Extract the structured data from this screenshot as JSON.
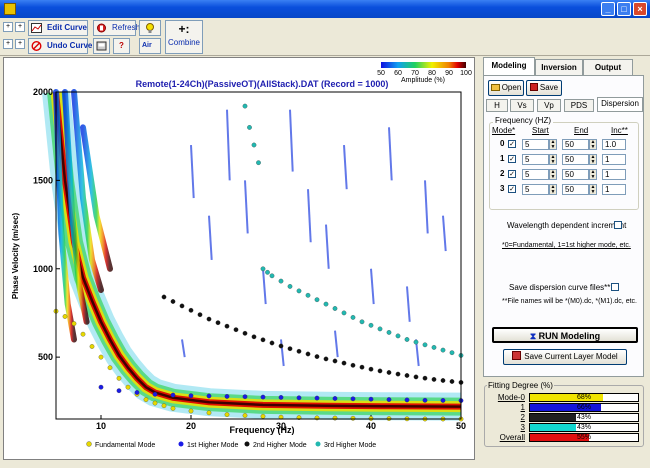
{
  "window": {
    "min": "_",
    "max": "□",
    "close": "×"
  },
  "toolbar": {
    "plus1": "+",
    "plus2": "+",
    "plus3": "+",
    "plus4": "+",
    "edit_curve": "Edit Curve",
    "undo_curve": "Undo Curve",
    "refresh": "Refresh",
    "bulb": "💡",
    "help": "?",
    "air": "Air",
    "combine": "Combine"
  },
  "plot": {
    "title": "Remote(1-24Ch)(PassiveOT)(AllStack).DAT (Record = 1000)",
    "colorbar_label": "Amplitude (%)",
    "colorbar_ticks": [
      "50",
      "60",
      "70",
      "80",
      "90",
      "100"
    ],
    "xlabel": "Frequency (Hz)",
    "ylabel": "Phase Velocity (m/sec)",
    "legend": [
      "Fundamental Mode",
      "1st Higher Mode",
      "2nd Higher Mode",
      "3rd Higher Mode"
    ]
  },
  "chart_data": {
    "type": "scatter",
    "title": "Remote(1-24Ch)(PassiveOT)(AllStack).DAT (Record = 1000)",
    "xlabel": "Frequency (Hz)",
    "ylabel": "Phase Velocity (m/sec)",
    "xlim": [
      5,
      50
    ],
    "ylim": [
      150,
      2000
    ],
    "xticks": [
      10,
      20,
      30,
      40,
      50
    ],
    "yticks": [
      500,
      1000,
      1500,
      2000
    ],
    "legend_position": "bottom",
    "series": [
      {
        "name": "Fundamental Mode",
        "color": "#e6d800",
        "x": [
          5,
          6,
          7,
          8,
          9,
          10,
          11,
          12,
          13,
          14,
          15,
          16,
          17,
          18,
          20,
          22,
          24,
          26,
          28,
          30,
          32,
          34,
          36,
          38,
          40,
          42,
          44,
          46,
          48,
          50
        ],
        "y": [
          760,
          730,
          690,
          630,
          560,
          500,
          440,
          380,
          330,
          290,
          260,
          240,
          225,
          210,
          195,
          185,
          175,
          170,
          165,
          160,
          158,
          156,
          155,
          154,
          153,
          152,
          151,
          150,
          150,
          150
        ]
      },
      {
        "name": "1st Higher Mode",
        "color": "#1a1ae6",
        "x": [
          10,
          12,
          14,
          16,
          18,
          20,
          22,
          24,
          26,
          28,
          30,
          32,
          34,
          36,
          38,
          40,
          42,
          44,
          46,
          48,
          50
        ],
        "y": [
          330,
          310,
          300,
          290,
          285,
          282,
          280,
          278,
          276,
          274,
          272,
          270,
          268,
          266,
          264,
          262,
          260,
          258,
          256,
          255,
          254
        ]
      },
      {
        "name": "2nd Higher Mode",
        "color": "#111111",
        "x": [
          17,
          18,
          19,
          20,
          21,
          22,
          23,
          24,
          25,
          26,
          27,
          28,
          29,
          30,
          31,
          32,
          33,
          34,
          35,
          36,
          37,
          38,
          39,
          40,
          41,
          42,
          43,
          44,
          45,
          46,
          47,
          48,
          49,
          50
        ],
        "y": [
          840,
          815,
          790,
          765,
          740,
          715,
          695,
          675,
          655,
          635,
          615,
          598,
          580,
          563,
          548,
          533,
          518,
          503,
          490,
          478,
          466,
          454,
          443,
          432,
          422,
          413,
          404,
          396,
          388,
          381,
          374,
          368,
          362,
          357
        ]
      },
      {
        "name": "3rd Higher Mode",
        "color": "#22b8b0",
        "x": [
          26,
          26.5,
          27,
          27.5,
          28,
          28.5,
          29,
          30,
          31,
          32,
          33,
          34,
          35,
          36,
          37,
          38,
          39,
          40,
          41,
          42,
          43,
          44,
          45,
          46,
          47,
          48,
          49,
          50
        ],
        "y": [
          1920,
          1800,
          1700,
          1600,
          1000,
          980,
          960,
          930,
          900,
          875,
          850,
          825,
          800,
          775,
          750,
          725,
          700,
          680,
          660,
          640,
          620,
          600,
          585,
          570,
          555,
          540,
          525,
          510
        ]
      }
    ]
  },
  "right": {
    "tabs": [
      "Modeling",
      "Inversion",
      "Output"
    ],
    "open": "Open",
    "save": "Save",
    "subtabs": [
      "H",
      "Vs",
      "Vp",
      "PDS",
      "Dispersion"
    ],
    "freq_group": "Frequency (HZ)",
    "cols": [
      "Mode*",
      "Start",
      "End",
      "Inc**"
    ],
    "rows": [
      {
        "mode": "0",
        "start": "5",
        "end": "50",
        "inc": "1.0"
      },
      {
        "mode": "1",
        "start": "5",
        "end": "50",
        "inc": "1"
      },
      {
        "mode": "2",
        "start": "5",
        "end": "50",
        "inc": "1"
      },
      {
        "mode": "3",
        "start": "5",
        "end": "50",
        "inc": "1"
      }
    ],
    "wavelength": "Wavelength dependent increment",
    "note1": "*0=Fundamental, 1=1st higher mode, etc.",
    "save_disp": "Save dispersion curve files**",
    "note2": "**File names will be *(M0).dc, *(M1).dc, etc.",
    "run": "RUN Modeling",
    "save_layer": "Save Current Layer Model",
    "fit_title": "Fitting Degree (%)",
    "fit": [
      {
        "label": "Mode-0",
        "value": "68%",
        "pct": 68,
        "color": "#f0e400"
      },
      {
        "label": "1",
        "value": "66%",
        "pct": 66,
        "color": "#1414d8"
      },
      {
        "label": "2",
        "value": "43%",
        "pct": 43,
        "color": "#202020"
      },
      {
        "label": "3",
        "value": "43%",
        "pct": 43,
        "color": "#12d8d0"
      },
      {
        "label": "Overall",
        "value": "55%",
        "pct": 55,
        "color": "#e01010"
      }
    ]
  }
}
